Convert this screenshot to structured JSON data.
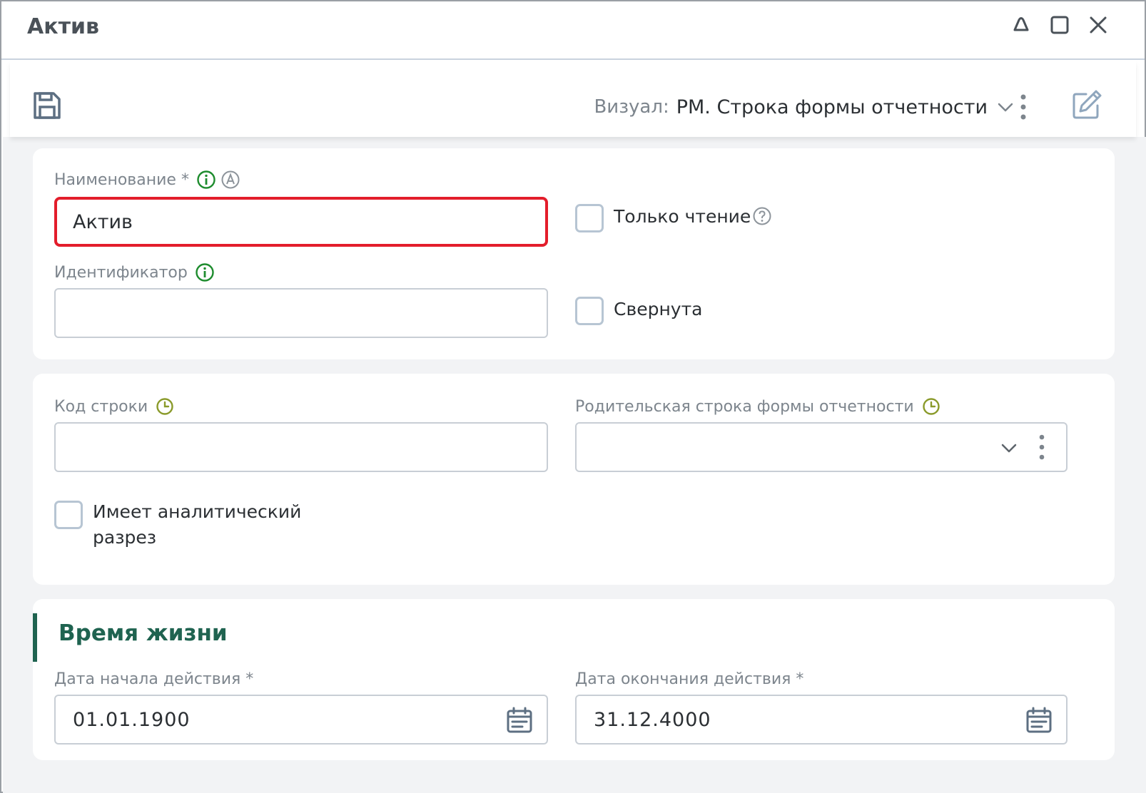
{
  "window": {
    "title": "Актив"
  },
  "toolbar": {
    "visual_label": "Визуал:",
    "visual_value": "РМ. Строка формы отчетности"
  },
  "card_main": {
    "name_label": "Наименование *",
    "name_value": "Актив",
    "id_label": "Идентификатор",
    "id_value": "",
    "readonly_label": "Только чтение",
    "collapsed_label": "Свернута"
  },
  "card_codes": {
    "code_label": "Код строки",
    "code_value": "",
    "parent_label": "Родительская строка формы отчетности",
    "parent_value": "",
    "analytic_label_line1": "Имеет аналитический",
    "analytic_label_line2": "разрез"
  },
  "card_lifetime": {
    "section_title": "Время жизни",
    "start_label": "Дата начала действия *",
    "start_value": "01.01.1900",
    "end_label": "Дата окончания действия *",
    "end_value": "31.12.4000"
  },
  "colors": {
    "accent_green": "#1f6350",
    "info_green": "#1e8c2e",
    "history_olive": "#8a9a2a",
    "error_red": "#e31d2b",
    "border_gray": "#c8ced5"
  }
}
